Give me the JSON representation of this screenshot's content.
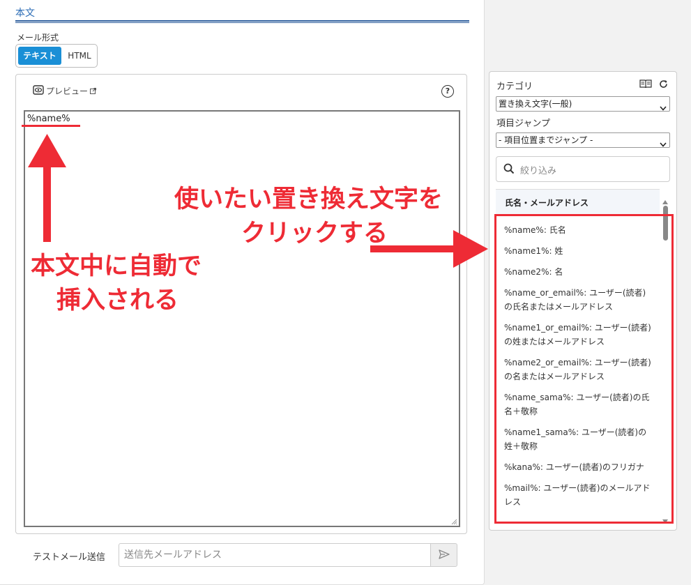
{
  "body_section": {
    "title": "本文",
    "format_label": "メール形式",
    "format_options": {
      "text": "テキスト",
      "html": "HTML"
    }
  },
  "editor": {
    "preview_label": "プレビュー",
    "help_symbol": "?",
    "content": "%name%"
  },
  "test_send": {
    "label": "テストメール送信",
    "placeholder": "送信先メールアドレス"
  },
  "side_panel": {
    "category_label": "カテゴリ",
    "category_value": "置き換え文字(一般)",
    "jump_label": "項目ジャンプ",
    "jump_value": "- 項目位置までジャンプ -",
    "search_placeholder": "絞り込み",
    "group_header": "氏名・メールアドレス",
    "items": [
      "%name%: 氏名",
      "%name1%: 姓",
      "%name2%: 名",
      "%name_or_email%: ユーザー(読者)の氏名またはメールアドレス",
      "%name1_or_email%: ユーザー(読者)の姓またはメールアドレス",
      "%name2_or_email%: ユーザー(読者)の名またはメールアドレス",
      "%name_sama%: ユーザー(読者)の氏名＋敬称",
      "%name1_sama%: ユーザー(読者)の姓＋敬称",
      "%kana%: ユーザー(読者)のフリガナ",
      "%mail%: ユーザー(読者)のメールアドレス"
    ]
  },
  "annotations": {
    "left_line1": "本文中に自動で",
    "left_line2": "挿入される",
    "right_line1": "使いたい置き換え文字を",
    "right_line2": "クリックする",
    "color": "#ee2b35"
  }
}
